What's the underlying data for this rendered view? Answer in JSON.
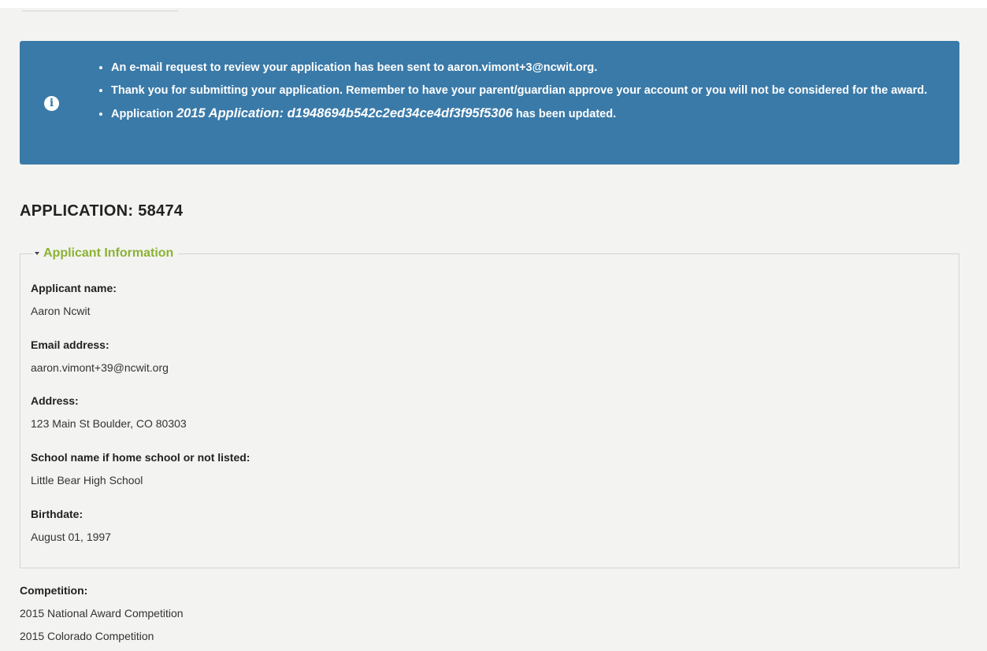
{
  "alert": {
    "icon": "info-icon",
    "color": "#3a7aa8",
    "messages": {
      "review_request": "An e-mail request to review your application has been sent to aaron.vimont+3@ncwit.org.",
      "thank_you": "Thank you for submitting your application. Remember to have your parent/guardian approve your account or you will not be considered for the award.",
      "updated_prefix": "Application",
      "updated_name": "2015 Application: d1948694b542c2ed34ce4df3f95f5306",
      "updated_suffix": "has been updated."
    }
  },
  "page": {
    "title": "APPLICATION: 58474"
  },
  "applicant_info": {
    "legend": "Applicant Information",
    "legend_color": "#8bb234",
    "fields": {
      "name": {
        "label": "Applicant name:",
        "value": "Aaron Ncwit"
      },
      "email": {
        "label": "Email address:",
        "value": "aaron.vimont+39@ncwit.org"
      },
      "address": {
        "label": "Address:",
        "value": "123 Main St Boulder, CO 80303"
      },
      "school": {
        "label": "School name if home school or not listed:",
        "value": "Little Bear High School"
      },
      "birthdate": {
        "label": "Birthdate:",
        "value": "August 01, 1997"
      }
    }
  },
  "competition": {
    "label": "Competition:",
    "values": [
      "2015 National Award Competition",
      "2015 Colorado Competition"
    ]
  }
}
